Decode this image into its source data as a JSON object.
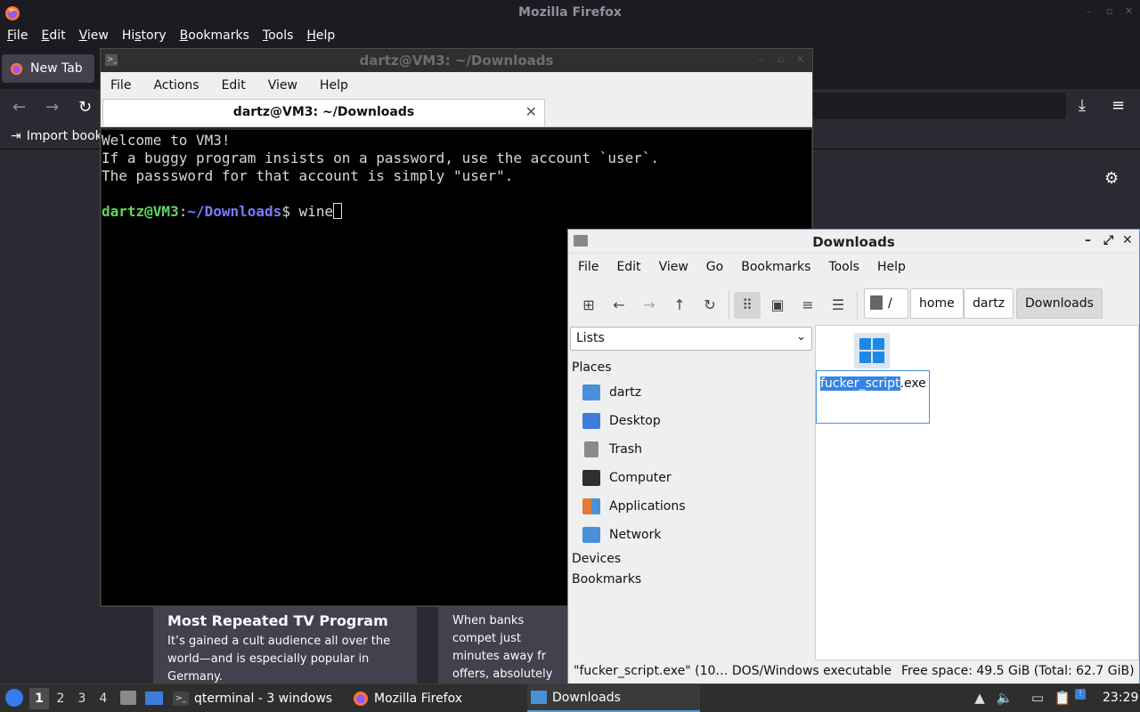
{
  "firefox": {
    "title": "Mozilla Firefox",
    "menu": [
      "File",
      "Edit",
      "View",
      "History",
      "Bookmarks",
      "Tools",
      "Help"
    ],
    "menu_mnemonics": [
      "F",
      "E",
      "V",
      "s",
      "B",
      "T",
      "H"
    ],
    "tab_label": "New Tab",
    "import_label": "Import book",
    "story1": {
      "title": "Most Repeated TV Program",
      "text": "It’s gained a cult audience all over the world—and is especially popular in Germany."
    },
    "story2": {
      "text": "When banks compet just minutes away fr offers, absolutely fre"
    }
  },
  "terminal": {
    "title": "dartz@VM3: ~/Downloads",
    "menu": [
      "File",
      "Actions",
      "Edit",
      "View",
      "Help"
    ],
    "tab_label": "dartz@VM3: ~/Downloads",
    "lines": [
      "Welcome to VM3!",
      "If a buggy program insists on a password, use the account `user`.",
      "The passsword for that account is simply \"user\"."
    ],
    "prompt_user": "dartz@VM3",
    "prompt_sep": ":",
    "prompt_path": "~/Downloads",
    "prompt_symbol": "$ ",
    "command": "wine"
  },
  "filemanager": {
    "title": "Downloads",
    "menu": [
      "File",
      "Edit",
      "View",
      "Go",
      "Bookmarks",
      "Tools",
      "Help"
    ],
    "breadcrumbs": [
      "/",
      "home",
      "dartz",
      "Downloads"
    ],
    "side_select": "Lists",
    "places_header": "Places",
    "places": [
      {
        "label": "dartz",
        "icon": "home-folder-icon",
        "color": "#4a90d9"
      },
      {
        "label": "Desktop",
        "icon": "desktop-icon",
        "color": "#3b7dd8"
      },
      {
        "label": "Trash",
        "icon": "trash-icon",
        "color": "#8a8a8a"
      },
      {
        "label": "Computer",
        "icon": "computer-icon",
        "color": "#2f2f2f"
      },
      {
        "label": "Applications",
        "icon": "applications-icon",
        "color": "#e07b39"
      },
      {
        "label": "Network",
        "icon": "network-icon",
        "color": "#4a90d9"
      }
    ],
    "devices_header": "Devices",
    "bookmarks_header": "Bookmarks",
    "file": {
      "name_selected": "fucker_script",
      "name_rest": ".exe",
      "icon": "windows-executable-icon"
    },
    "status_left": "\"fucker_script.exe\" (10… DOS/Windows executable",
    "status_right": "Free space: 49.5 GiB (Total: 62.7 GiB)"
  },
  "panel": {
    "workspaces": [
      "1",
      "2",
      "3",
      "4"
    ],
    "active_workspace": "1",
    "tasks": [
      {
        "label": "qterminal - 3 windows",
        "icon": "terminal-icon"
      },
      {
        "label": "Mozilla Firefox",
        "icon": "firefox-icon"
      },
      {
        "label": "Downloads",
        "icon": "folder-icon"
      }
    ],
    "clock": "23:29"
  },
  "colors": {
    "firefox_bg": "#2b2a33",
    "terminal_bg": "#000000",
    "prompt_user": "#5fd75f",
    "prompt_path": "#7b7bff",
    "selection": "#3584e4",
    "panel_bg": "#2e2e2e"
  }
}
